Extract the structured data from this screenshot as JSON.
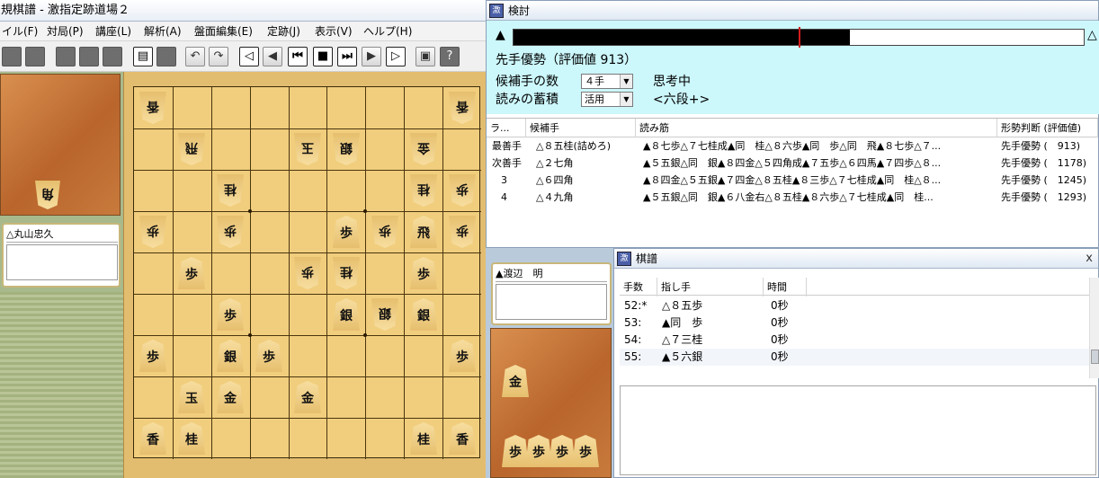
{
  "main_window": {
    "title": "規棋譜 - 激指定跡道場２",
    "menu": [
      "イル(F)",
      "対局(P)",
      "講座(L)",
      "解析(A)",
      "盤面編集(E)",
      "定跡(J)",
      "表示(V)",
      "ヘルプ(H)"
    ]
  },
  "toolbar": {
    "icons": [
      "new-icon",
      "open-icon",
      "save-icon",
      "print-icon",
      "edit-icon",
      "board-icon",
      "undo-icon",
      "redo-icon",
      "back-icon",
      "prev-icon",
      "first-icon",
      "stop-icon",
      "last-icon",
      "next-icon",
      "forward-icon",
      "monitor-icon",
      "help-icon"
    ]
  },
  "players": {
    "gote": "△丸山忠久",
    "sente": "▲渡辺　明"
  },
  "hands": {
    "gote": [
      "角"
    ],
    "sente": [
      "金",
      "歩",
      "歩",
      "歩",
      "歩"
    ]
  },
  "board": [
    {
      "file": 9,
      "rank": 1,
      "piece": "香",
      "side": "gote"
    },
    {
      "file": 1,
      "rank": 1,
      "piece": "香",
      "side": "gote"
    },
    {
      "file": 8,
      "rank": 2,
      "piece": "飛",
      "side": "gote"
    },
    {
      "file": 5,
      "rank": 2,
      "piece": "玉",
      "side": "gote"
    },
    {
      "file": 4,
      "rank": 2,
      "piece": "銀",
      "side": "gote"
    },
    {
      "file": 2,
      "rank": 2,
      "piece": "金",
      "side": "gote"
    },
    {
      "file": 7,
      "rank": 3,
      "piece": "桂",
      "side": "gote"
    },
    {
      "file": 2,
      "rank": 3,
      "piece": "桂",
      "side": "gote"
    },
    {
      "file": 1,
      "rank": 3,
      "piece": "歩",
      "side": "gote"
    },
    {
      "file": 9,
      "rank": 4,
      "piece": "歩",
      "side": "gote"
    },
    {
      "file": 7,
      "rank": 4,
      "piece": "歩",
      "side": "gote"
    },
    {
      "file": 4,
      "rank": 4,
      "piece": "歩",
      "side": "sente"
    },
    {
      "file": 3,
      "rank": 4,
      "piece": "歩",
      "side": "gote"
    },
    {
      "file": 2,
      "rank": 4,
      "piece": "飛",
      "side": "sente"
    },
    {
      "file": 1,
      "rank": 4,
      "piece": "歩",
      "side": "gote"
    },
    {
      "file": 8,
      "rank": 5,
      "piece": "歩",
      "side": "sente"
    },
    {
      "file": 5,
      "rank": 5,
      "piece": "歩",
      "side": "gote"
    },
    {
      "file": 4,
      "rank": 5,
      "piece": "桂",
      "side": "gote"
    },
    {
      "file": 2,
      "rank": 5,
      "piece": "歩",
      "side": "sente"
    },
    {
      "file": 7,
      "rank": 6,
      "piece": "歩",
      "side": "sente"
    },
    {
      "file": 4,
      "rank": 6,
      "piece": "銀",
      "side": "sente"
    },
    {
      "file": 3,
      "rank": 6,
      "piece": "銀",
      "side": "gote"
    },
    {
      "file": 2,
      "rank": 6,
      "piece": "銀",
      "side": "sente"
    },
    {
      "file": 9,
      "rank": 7,
      "piece": "歩",
      "side": "sente"
    },
    {
      "file": 7,
      "rank": 7,
      "piece": "銀",
      "side": "sente"
    },
    {
      "file": 6,
      "rank": 7,
      "piece": "歩",
      "side": "sente"
    },
    {
      "file": 1,
      "rank": 7,
      "piece": "歩",
      "side": "sente"
    },
    {
      "file": 8,
      "rank": 8,
      "piece": "玉",
      "side": "sente"
    },
    {
      "file": 7,
      "rank": 8,
      "piece": "金",
      "side": "sente"
    },
    {
      "file": 5,
      "rank": 8,
      "piece": "金",
      "side": "sente"
    },
    {
      "file": 9,
      "rank": 9,
      "piece": "香",
      "side": "sente"
    },
    {
      "file": 8,
      "rank": 9,
      "piece": "桂",
      "side": "sente"
    },
    {
      "file": 2,
      "rank": 9,
      "piece": "桂",
      "side": "sente"
    },
    {
      "file": 1,
      "rank": 9,
      "piece": "香",
      "side": "sente"
    }
  ],
  "analysis": {
    "title": "検討",
    "eval_text": "先手優勢（評価値 913）",
    "eval_fraction": 0.59,
    "candidates_label": "候補手の数",
    "candidates_value": "４手",
    "accumulate_label": "読みの蓄積",
    "accumulate_value": "活用",
    "status": "思考中",
    "rank": "<六段+>",
    "columns": [
      "ラ...",
      "候補手",
      "読み筋",
      "形勢判断 (評価値)"
    ],
    "rows": [
      {
        "rank": "最善手",
        "move": "△８五桂(詰めろ)",
        "line": "▲８七歩△７七桂成▲同　桂△８六歩▲同　歩△同　飛▲８七歩△７...",
        "eval": "先手優勢 (　913)"
      },
      {
        "rank": "次善手",
        "move": "△２七角",
        "line": "▲５五銀△同　銀▲８四金△５四角成▲７五歩△６四馬▲７四歩△８...",
        "eval": "先手優勢 (　1178)"
      },
      {
        "rank": "3",
        "move": "△６四角",
        "line": "▲８四金△５五銀▲７四金△８五桂▲８三歩△７七桂成▲同　桂△８...",
        "eval": "先手優勢 (　1245)"
      },
      {
        "rank": "4",
        "move": "△４九角",
        "line": "▲５五銀△同　銀▲６八金右△８五桂▲８六歩△７七桂成▲同　桂...",
        "eval": "先手優勢 (　1293)"
      }
    ]
  },
  "kifu": {
    "title": "棋譜",
    "close": "x",
    "columns": [
      "手数",
      "指し手",
      "時間"
    ],
    "rows": [
      {
        "num": "52:*",
        "move": "△８五歩",
        "time": "0秒"
      },
      {
        "num": "53:",
        "move": "▲同　歩",
        "time": "0秒"
      },
      {
        "num": "54:",
        "move": "△７三桂",
        "time": "0秒"
      },
      {
        "num": "55:",
        "move": "▲５六銀",
        "time": "0秒"
      }
    ]
  }
}
